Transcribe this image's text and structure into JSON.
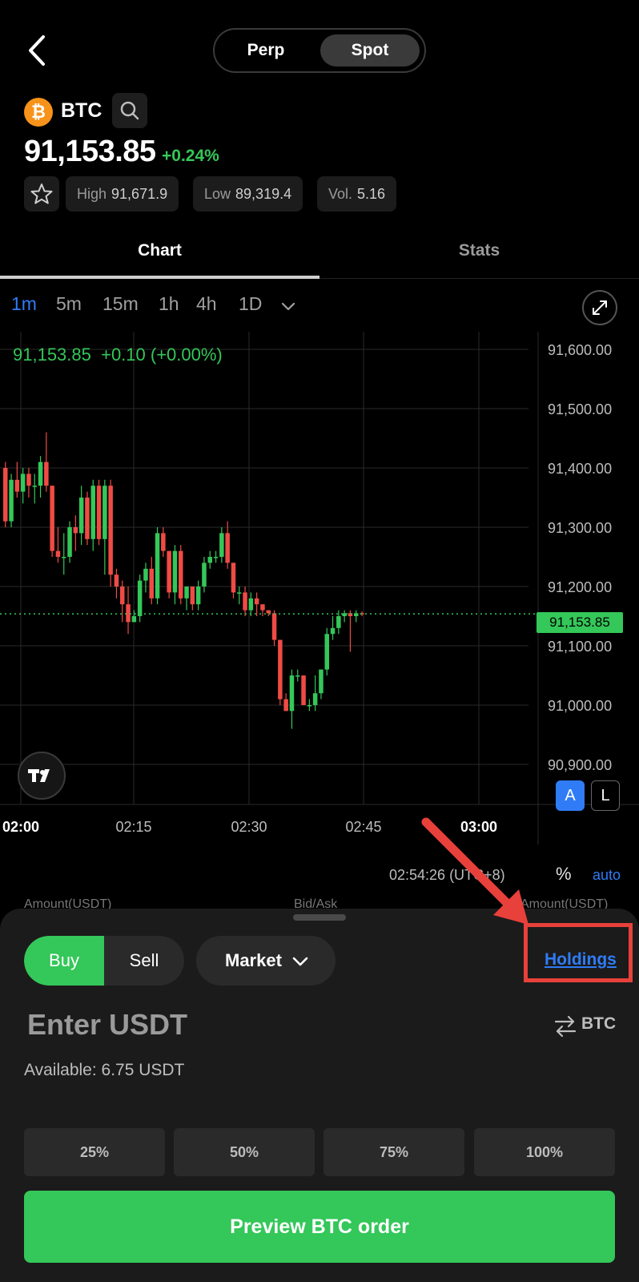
{
  "header": {
    "segments": [
      {
        "label": "Perp"
      },
      {
        "label": "Spot"
      }
    ],
    "active_segment": "Spot"
  },
  "ticker": {
    "coin": "BTC",
    "coin_symbol": "₿",
    "price": "91,153.85",
    "change": "+0.24%",
    "stats": [
      {
        "label": "High",
        "value": "91,671.9"
      },
      {
        "label": "Low",
        "value": "89,319.4"
      },
      {
        "label": "Vol.",
        "value": "5.16"
      }
    ]
  },
  "tabs": [
    {
      "label": "Chart"
    },
    {
      "label": "Stats"
    }
  ],
  "timeframes": [
    {
      "label": "1m"
    },
    {
      "label": "5m"
    },
    {
      "label": "15m"
    },
    {
      "label": "1h"
    },
    {
      "label": "4h"
    },
    {
      "label": "1D"
    }
  ],
  "active_timeframe": "1m",
  "chart": {
    "ohlc_text": "91,153.85  +0.10 (+0.00%)",
    "current_price_tag": "91,153.85",
    "y_ticks": [
      "91,600.00",
      "91,500.00",
      "91,400.00",
      "91,300.00",
      "91,200.00",
      "91,100.00",
      "91,000.00",
      "90,900.00"
    ],
    "x_ticks": [
      "02:00",
      "02:15",
      "02:30",
      "02:45",
      "03:00"
    ],
    "axis_mode_a": "A",
    "axis_mode_l": "L",
    "time_readout": "02:54:26 (UTC+8)",
    "pct_toggle": "%",
    "auto_toggle": "auto",
    "colors": {
      "up": "#34c759",
      "down": "#ef4b45",
      "accent": "#2f7cf6"
    }
  },
  "chart_data": {
    "type": "candlestick",
    "ylim": [
      90900,
      91650
    ],
    "y_ticks": [
      91600,
      91500,
      91400,
      91300,
      91200,
      91100,
      91000,
      90900
    ],
    "x_ticks": [
      "02:00",
      "02:15",
      "02:30",
      "02:45",
      "03:00"
    ],
    "last_price": 91153.85,
    "candles": [
      [
        91400,
        91410,
        91300,
        91310
      ],
      [
        91310,
        91390,
        91300,
        91380
      ],
      [
        91380,
        91410,
        91350,
        91360
      ],
      [
        91360,
        91400,
        91340,
        91390
      ],
      [
        91390,
        91400,
        91350,
        91370
      ],
      [
        91370,
        91390,
        91340,
        91370
      ],
      [
        91370,
        91420,
        91350,
        91410
      ],
      [
        91410,
        91460,
        91360,
        91370
      ],
      [
        91370,
        91370,
        91250,
        91260
      ],
      [
        91260,
        91300,
        91240,
        91250
      ],
      [
        91250,
        91290,
        91220,
        91250
      ],
      [
        91250,
        91310,
        91240,
        91300
      ],
      [
        91300,
        91320,
        91260,
        91290
      ],
      [
        91290,
        91370,
        91270,
        91350
      ],
      [
        91350,
        91360,
        91270,
        91280
      ],
      [
        91280,
        91380,
        91260,
        91370
      ],
      [
        91370,
        91380,
        91270,
        91280
      ],
      [
        91280,
        91380,
        91220,
        91370
      ],
      [
        91370,
        91380,
        91200,
        91220
      ],
      [
        91220,
        91230,
        91180,
        91200
      ],
      [
        91200,
        91210,
        91140,
        91170
      ],
      [
        91170,
        91200,
        91120,
        91140
      ],
      [
        91140,
        91160,
        91140,
        91150
      ],
      [
        91150,
        91220,
        91140,
        91210
      ],
      [
        91210,
        91240,
        91190,
        91230
      ],
      [
        91230,
        91250,
        91170,
        91180
      ],
      [
        91180,
        91300,
        91170,
        91290
      ],
      [
        91290,
        91300,
        91250,
        91260
      ],
      [
        91260,
        91260,
        91180,
        91190
      ],
      [
        91190,
        91270,
        91170,
        91260
      ],
      [
        91260,
        91270,
        91170,
        91180
      ],
      [
        91180,
        91200,
        91160,
        91200
      ],
      [
        91200,
        91200,
        91160,
        91170
      ],
      [
        91170,
        91210,
        91160,
        91200
      ],
      [
        91200,
        91250,
        91190,
        91240
      ],
      [
        91240,
        91260,
        91230,
        91250
      ],
      [
        91250,
        91260,
        91240,
        91250
      ],
      [
        91250,
        91300,
        91240,
        91290
      ],
      [
        91290,
        91310,
        91230,
        91240
      ],
      [
        91240,
        91240,
        91180,
        91190
      ],
      [
        91190,
        91200,
        91170,
        91190
      ],
      [
        91190,
        91200,
        91150,
        91160
      ],
      [
        91160,
        91190,
        91150,
        91180
      ],
      [
        91180,
        91190,
        91150,
        91170
      ],
      [
        91170,
        91170,
        91150,
        91160
      ],
      [
        91160,
        91160,
        91150,
        91155
      ],
      [
        91155,
        91160,
        91100,
        91110
      ],
      [
        91110,
        91110,
        91000,
        91010
      ],
      [
        91010,
        91020,
        90990,
        90990
      ],
      [
        90990,
        91060,
        90960,
        91050
      ],
      [
        91050,
        91060,
        91040,
        91050
      ],
      [
        91050,
        91050,
        91000,
        91000
      ],
      [
        91000,
        91010,
        90990,
        91000
      ],
      [
        91000,
        91050,
        90990,
        91020
      ],
      [
        91020,
        91060,
        91010,
        91060
      ],
      [
        91060,
        91130,
        91050,
        91120
      ],
      [
        91120,
        91150,
        91110,
        91130
      ],
      [
        91130,
        91160,
        91120,
        91150
      ],
      [
        91150,
        91160,
        91140,
        91155
      ],
      [
        91155,
        91160,
        91090,
        91150
      ],
      [
        91150,
        91160,
        91140,
        91155
      ],
      [
        91155,
        91158,
        91150,
        91154
      ]
    ]
  },
  "orderbook_header": {
    "left": "Amount(USDT)",
    "center": "Bid/Ask",
    "right": "Amount(USDT)"
  },
  "order": {
    "buy_label": "Buy",
    "sell_label": "Sell",
    "type_label": "Market",
    "holdings_label": "Holdings",
    "amount_placeholder": "Enter USDT",
    "swap_label": "BTC",
    "available": "Available: 6.75 USDT",
    "percents": [
      {
        "label": "25%"
      },
      {
        "label": "50%"
      },
      {
        "label": "75%"
      },
      {
        "label": "100%"
      }
    ],
    "submit_label": "Preview BTC order"
  }
}
